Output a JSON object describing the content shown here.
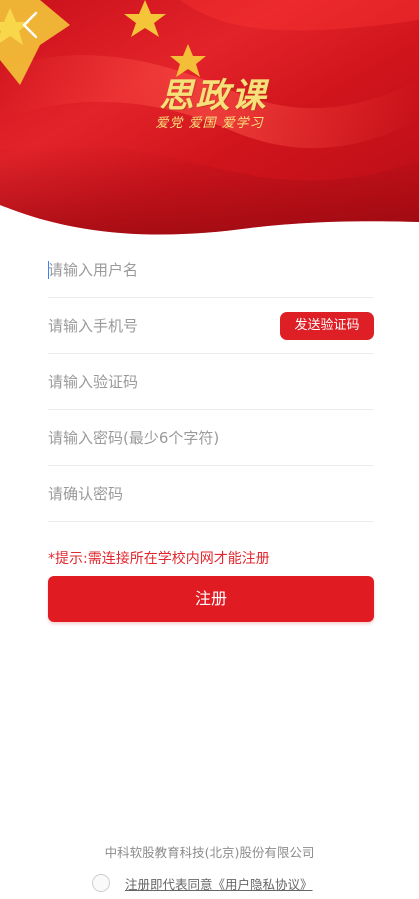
{
  "header": {
    "logo_title": "思政课",
    "logo_slogan": "爱党 爱国 爱学习"
  },
  "form": {
    "username_placeholder": "请输入用户名",
    "phone_placeholder": "请输入手机号",
    "send_code_label": "发送验证码",
    "code_placeholder": "请输入验证码",
    "password_placeholder": "请输入密码(最少6个字符)",
    "confirm_placeholder": "请确认密码"
  },
  "notice": "*提示:需连接所在学校内网才能注册",
  "register_label": "注册",
  "footer": {
    "company": "中科软股教育科技(北京)股份有限公司",
    "agree_prefix": "注册即代表同意",
    "agree_link": "《用户隐私协议》"
  },
  "colors": {
    "primary": "#e11b22",
    "logo_gold": "#f6e07a"
  },
  "icons": {
    "back": "chevron-left-icon",
    "flag_star": "star-icon"
  }
}
